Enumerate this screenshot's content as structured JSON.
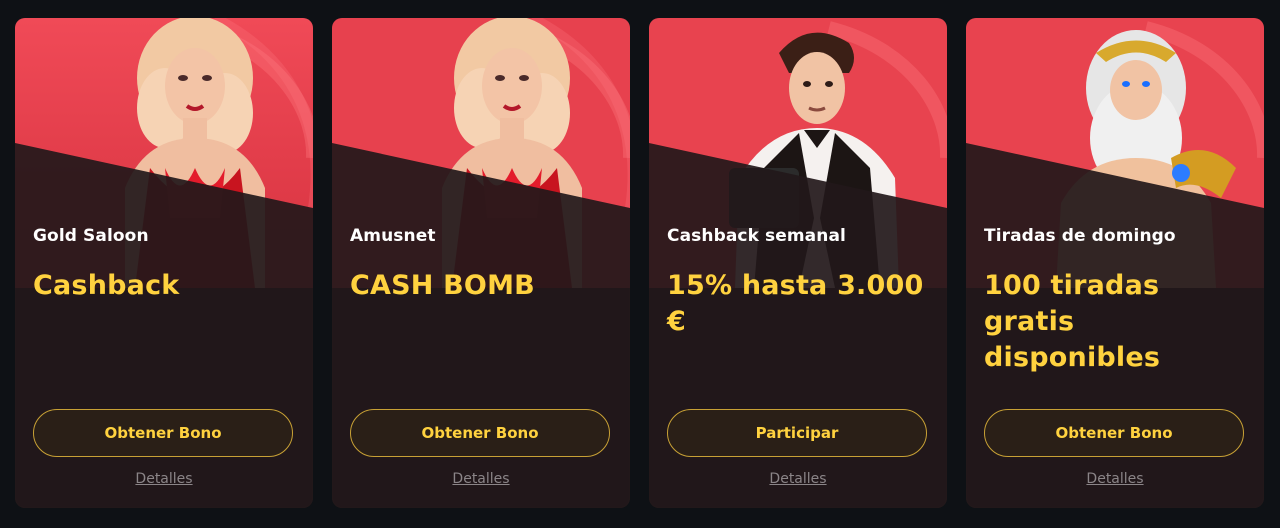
{
  "promotions": [
    {
      "provider": "Gold Saloon",
      "offer": "Cashback",
      "cta": "Obtener Bono",
      "details": "Detalles",
      "artwork": "blonde-woman-red-dress"
    },
    {
      "provider": "Amusnet",
      "offer": "CASH BOMB",
      "cta": "Obtener Bono",
      "details": "Detalles",
      "artwork": "blonde-woman-red-dress"
    },
    {
      "provider": "Cashback semanal",
      "offer": "15% hasta 3.000 €",
      "cta": "Participar",
      "details": "Detalles",
      "artwork": "dealer-man-vest"
    },
    {
      "provider": "Tiradas de domingo",
      "offer": "100 tiradas gratis disponibles",
      "cta": "Obtener Bono",
      "details": "Detalles",
      "artwork": "zeus-god"
    }
  ],
  "colors": {
    "page_bg": "#0e1115",
    "card_bg": "#22181a",
    "art_red": "#e8434f",
    "offer_yellow": "#ffd23f",
    "button_border": "#c8a135"
  }
}
